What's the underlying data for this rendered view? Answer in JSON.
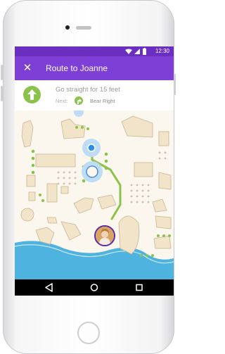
{
  "status_bar": {
    "time": "12:30"
  },
  "app_bar": {
    "title": "Route to Joanne",
    "close_icon": "close-icon"
  },
  "directions": {
    "instruction": "Go straight for 15 feet",
    "next_label": "Next:",
    "next_step": "Bear Right",
    "turn_icon": "arrow-up-icon",
    "next_icon": "bear-right-icon"
  },
  "colors": {
    "accent": "#7e3fd6",
    "status_bar": "#6a2fc1",
    "route": "#8bc34a",
    "water": "#4fb3e0",
    "location": "#2f8ee0"
  },
  "navigation": {
    "back_icon": "back-icon",
    "home_icon": "home-icon",
    "recents_icon": "recents-icon"
  }
}
